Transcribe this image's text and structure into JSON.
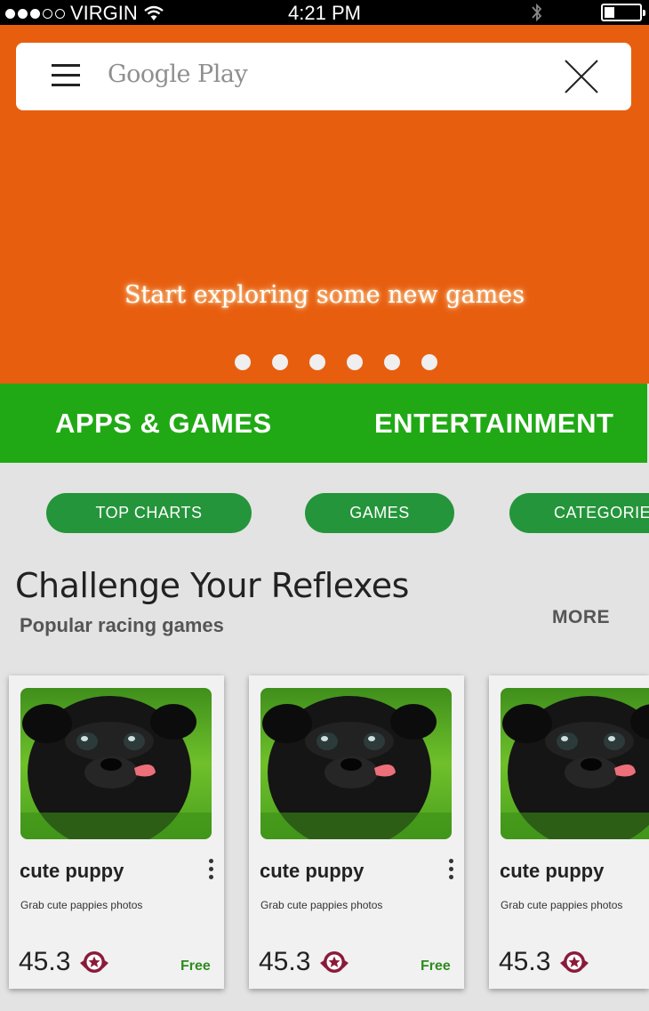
{
  "status_bar": {
    "carrier": "VIRGIN",
    "time": "4:21 PM"
  },
  "search": {
    "placeholder": "Google Play"
  },
  "hero": {
    "tagline": "Start exploring some new games",
    "slide_count": 6,
    "color": "#e85e0f"
  },
  "main_tabs": [
    {
      "label": "APPS & GAMES"
    },
    {
      "label": "ENTERTAINMENT"
    }
  ],
  "filters": [
    {
      "label": "TOP  CHARTS"
    },
    {
      "label": "GAMES"
    },
    {
      "label": "CATEGORIES"
    }
  ],
  "section": {
    "title": "Challenge Your Reflexes",
    "subtitle": "Popular racing games",
    "more_label": "MORE"
  },
  "cards": [
    {
      "name": "cute puppy",
      "description": "Grab cute pappies photos",
      "rating": "45.3",
      "price": "Free",
      "icon": "award-star-icon"
    },
    {
      "name": "cute puppy",
      "description": "Grab cute pappies photos",
      "rating": "45.3",
      "price": "Free",
      "icon": "award-star-icon"
    },
    {
      "name": "cute puppy",
      "description": "Grab cute pappies photos",
      "rating": "45.3",
      "price": "",
      "icon": "award-star-icon"
    }
  ],
  "colors": {
    "accent_orange": "#e85e0f",
    "nav_green": "#20a915",
    "pill_green": "#24953a",
    "price_green": "#2e8b1e"
  }
}
